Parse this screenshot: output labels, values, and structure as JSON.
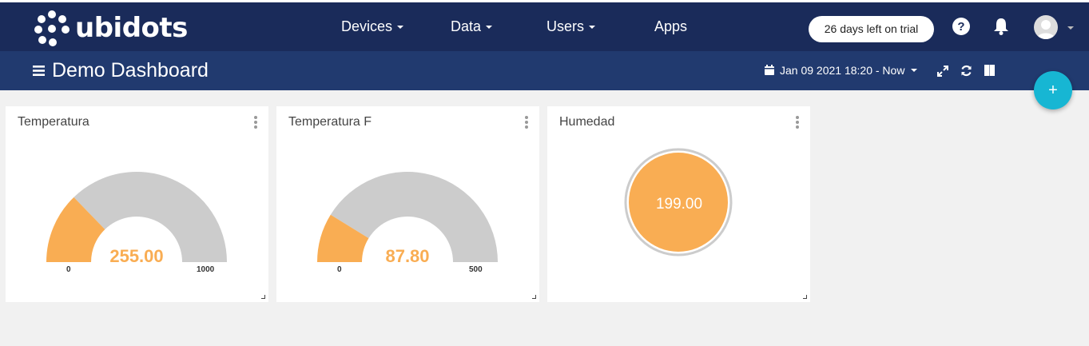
{
  "brand": {
    "name": "ubidots"
  },
  "nav": {
    "devices": "Devices",
    "data": "Data",
    "users": "Users",
    "apps": "Apps"
  },
  "trial": {
    "label": "26 days left on trial"
  },
  "dashboard": {
    "title": "Demo Dashboard",
    "date_range": "Jan 09 2021 18:20 - Now"
  },
  "fab": {
    "label": "+"
  },
  "widgets": [
    {
      "title": "Temperatura",
      "type": "gauge",
      "value": "255.00",
      "fraction": 0.255,
      "min": "0",
      "max": "1000"
    },
    {
      "title": "Temperatura F",
      "type": "gauge",
      "value": "87.80",
      "fraction": 0.1756,
      "min": "0",
      "max": "500"
    },
    {
      "title": "Humedad",
      "type": "indicator",
      "value": "199.00"
    }
  ],
  "colors": {
    "topbar": "#1a2b5a",
    "subbar": "#213a6f",
    "accent": "#f9ad53",
    "gauge_bg": "#cccccc",
    "fab": "#17b6d3"
  }
}
